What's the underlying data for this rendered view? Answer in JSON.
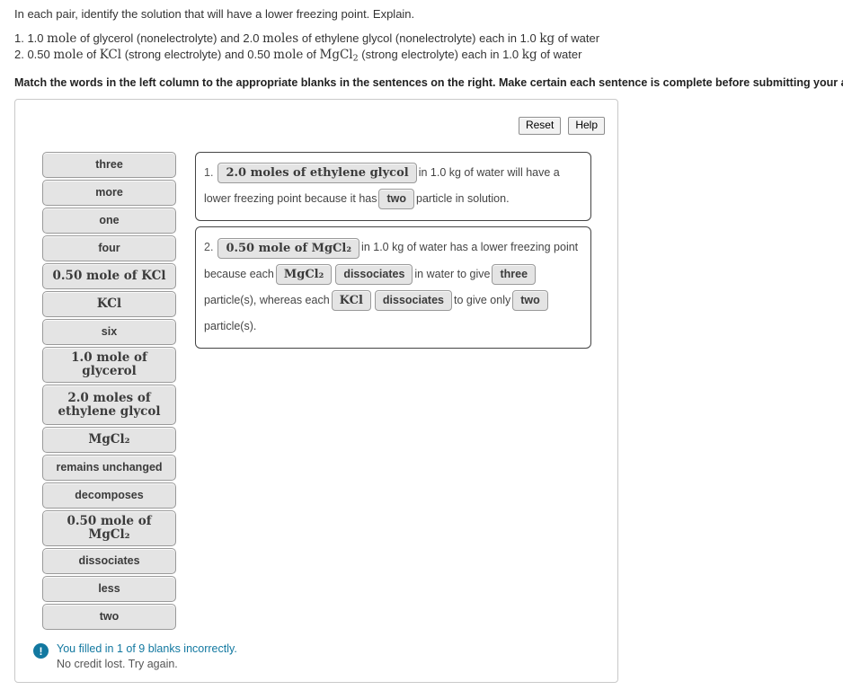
{
  "intro": {
    "prompt": "In each pair, identify the solution that will have a lower freezing point. Explain.",
    "pair1_pre": "1. 1.0 ",
    "pair1_m1": "mole",
    "pair1_mid1": " of glycerol (nonelectrolyte) and 2.0 ",
    "pair1_m2": "moles",
    "pair1_mid2": " of ethylene glycol (nonelectrolyte) each in 1.0 ",
    "pair1_m3": "kg",
    "pair1_end": " of water",
    "pair2_pre": "2. 0.50 ",
    "pair2_m1": "mole",
    "pair2_mid1": " of ",
    "pair2_m2": "KCl",
    "pair2_mid2": " (strong electrolyte) and 0.50 ",
    "pair2_m3": "mole",
    "pair2_mid3": " of ",
    "pair2_m4": "MgCl",
    "pair2_m4sub": "2",
    "pair2_mid4": " (strong electrolyte) each in 1.0 ",
    "pair2_m5": "kg",
    "pair2_end": " of water",
    "match_instruction": "Match the words in the left column to the appropriate blanks in the sentences on the right. Make certain each sentence is complete before submitting your answer."
  },
  "toolbar": {
    "reset_label": "Reset",
    "help_label": "Help"
  },
  "word_bank": [
    {
      "label": "three",
      "math": false,
      "tall": false
    },
    {
      "label": "more",
      "math": false,
      "tall": false
    },
    {
      "label": "one",
      "math": false,
      "tall": false
    },
    {
      "label": "four",
      "math": false,
      "tall": false
    },
    {
      "label": "0.50 mole of KCl",
      "math": true,
      "tall": false
    },
    {
      "label": "KCl",
      "math": true,
      "tall": false
    },
    {
      "label": "six",
      "math": false,
      "tall": false
    },
    {
      "label": "1.0 mole of glycerol",
      "math": true,
      "tall": false
    },
    {
      "label": "2.0 moles of ethylene glycol",
      "math": true,
      "tall": true
    },
    {
      "label": "MgCl₂",
      "math": true,
      "tall": false
    },
    {
      "label": "remains unchanged",
      "math": false,
      "tall": false
    },
    {
      "label": "decomposes",
      "math": false,
      "tall": false
    },
    {
      "label": "0.50 mole of MgCl₂",
      "math": true,
      "tall": false
    },
    {
      "label": "dissociates",
      "math": false,
      "tall": false
    },
    {
      "label": "less",
      "math": false,
      "tall": false
    },
    {
      "label": "two",
      "math": false,
      "tall": false
    }
  ],
  "sentence1": {
    "number": "1.",
    "blank1": "2.0 moles of ethylene glycol",
    "text1": "in 1.0 kg of water will have a lower freezing point because it has",
    "blank2": "two",
    "text2": "particle in solution."
  },
  "sentence2": {
    "number": "2.",
    "blank1": "0.50 mole of MgCl₂",
    "text1": "in 1.0 kg of water has a lower freezing point because each",
    "blank2": "MgCl₂",
    "blank3": "dissociates",
    "text2": "in water to give",
    "blank4": "three",
    "text3": "particle(s), whereas each",
    "blank5": "KCl",
    "blank6": "dissociates",
    "text4": "to give only",
    "blank7": "two",
    "text5": "particle(s)."
  },
  "feedback": {
    "icon": "exclamation-icon",
    "line1": "You filled in 1 of 9 blanks incorrectly.",
    "line2": "No credit lost. Try again.",
    "accent_color": "#1278a0"
  }
}
